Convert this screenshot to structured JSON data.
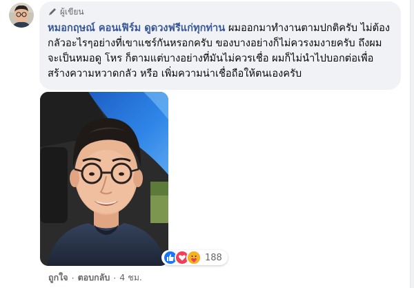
{
  "comment": {
    "author_label": "ผู้เขียน",
    "author_name": "หมอกฤษณ์ คอนเฟิร์ม ดูดวงฟรีแก่ทุกท่าน",
    "body": "ผมออกมาทำงานตามปกติครับ ไม่ต้องกลัวอะไรๆอย่างที่เขาแชร์กันหรอกครับ ของบางอย่างก็ไม่ควรงมงายครับ ถึงผมจะเป็นหมอดู โหร ก็ตามแต่บางอย่างที่มันไม่ควรเชื่อ ผมก็ไม่นำไปบอกต่อเพื่อสร้างความหวาดกลัว หรือ เพิ่มความน่าเชื่อถือให้ตนเองครับ"
  },
  "reactions": {
    "count": "188",
    "icons": [
      "like-icon",
      "love-icon",
      "care-icon"
    ],
    "colors": {
      "like": "#1877f2",
      "love": "#f33e58",
      "care": "#f7b125"
    }
  },
  "actions": {
    "like_label": "ถูกใจ",
    "reply_label": "ตอบกลับ",
    "separator": "·",
    "time_label": "4 ชม."
  },
  "colors": {
    "bubble": "#f0f2f5",
    "name": "#385898",
    "meta": "#65676b"
  }
}
